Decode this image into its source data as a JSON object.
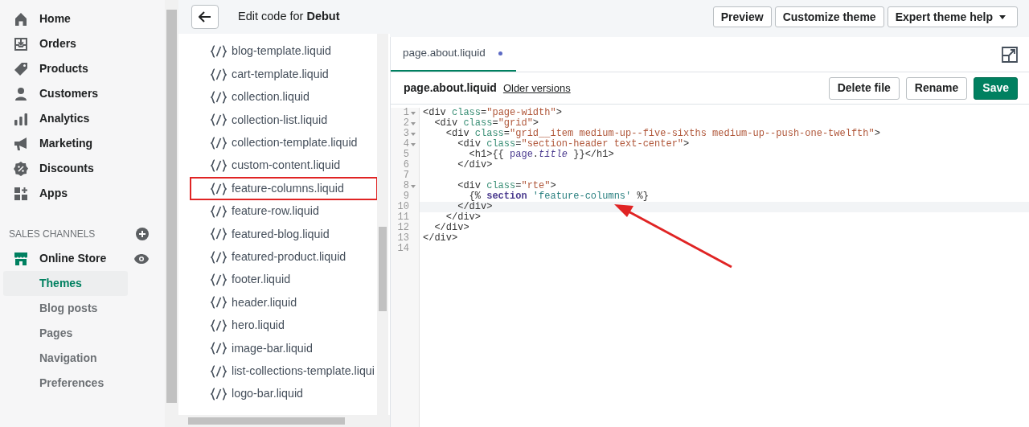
{
  "sidebar": {
    "items": [
      {
        "label": "Home",
        "kind": "home"
      },
      {
        "label": "Orders",
        "kind": "orders"
      },
      {
        "label": "Products",
        "kind": "tag"
      },
      {
        "label": "Customers",
        "kind": "person"
      },
      {
        "label": "Analytics",
        "kind": "bars"
      },
      {
        "label": "Marketing",
        "kind": "megaphone"
      },
      {
        "label": "Discounts",
        "kind": "discount"
      },
      {
        "label": "Apps",
        "kind": "apps"
      }
    ],
    "section_title": "SALES CHANNELS",
    "channel": {
      "label": "Online Store"
    },
    "subitems": [
      {
        "label": "Themes",
        "selected": true
      },
      {
        "label": "Blog posts",
        "selected": false
      },
      {
        "label": "Pages",
        "selected": false
      },
      {
        "label": "Navigation",
        "selected": false
      },
      {
        "label": "Preferences",
        "selected": false
      }
    ]
  },
  "header": {
    "title": "Edit code for **Debut**",
    "buttons": [
      {
        "label": "Preview",
        "kind": "plain"
      },
      {
        "label": "Customize theme",
        "kind": "plain"
      },
      {
        "label": "Expert theme help",
        "kind": "dropdown"
      }
    ]
  },
  "files": [
    {
      "name": "blog-template.liquid",
      "highlighted": false
    },
    {
      "name": "cart-template.liquid",
      "highlighted": false
    },
    {
      "name": "collection.liquid",
      "highlighted": false
    },
    {
      "name": "collection-list.liquid",
      "highlighted": false
    },
    {
      "name": "collection-template.liquid",
      "highlighted": false
    },
    {
      "name": "custom-content.liquid",
      "highlighted": false
    },
    {
      "name": "feature-columns.liquid",
      "highlighted": true
    },
    {
      "name": "feature-row.liquid",
      "highlighted": false
    },
    {
      "name": "featured-blog.liquid",
      "highlighted": false
    },
    {
      "name": "featured-product.liquid",
      "highlighted": false
    },
    {
      "name": "footer.liquid",
      "highlighted": false
    },
    {
      "name": "header.liquid",
      "highlighted": false
    },
    {
      "name": "hero.liquid",
      "highlighted": false
    },
    {
      "name": "image-bar.liquid",
      "highlighted": false
    },
    {
      "name": "list-collections-template.liqui",
      "highlighted": false
    },
    {
      "name": "logo-bar.liquid",
      "highlighted": false
    }
  ],
  "editor": {
    "tab": {
      "label": "page.about.liquid",
      "unsaved": true,
      "selected": true
    },
    "file_name": "page.about.liquid",
    "older_versions": "Older versions",
    "buttons": [
      {
        "label": "Delete file",
        "kind": "secondary"
      },
      {
        "label": "Rename",
        "kind": "secondary"
      },
      {
        "label": "Save",
        "kind": "primary"
      }
    ],
    "lines": [
      {
        "number": "1",
        "foldable": true,
        "active": false,
        "tokens": [
          {
            "kind": "tag",
            "text": "<div "
          },
          {
            "kind": "attr",
            "text": "class"
          },
          {
            "kind": "tag",
            "text": "="
          },
          {
            "kind": "string",
            "text": "\"page-width\""
          },
          {
            "kind": "tag",
            "text": ">"
          }
        ]
      },
      {
        "number": "2",
        "foldable": true,
        "active": false,
        "tokens": [
          {
            "kind": "tag",
            "text": "  <div "
          },
          {
            "kind": "attr",
            "text": "class"
          },
          {
            "kind": "tag",
            "text": "="
          },
          {
            "kind": "string",
            "text": "\"grid\""
          },
          {
            "kind": "tag",
            "text": ">"
          }
        ]
      },
      {
        "number": "3",
        "foldable": true,
        "active": false,
        "tokens": [
          {
            "kind": "tag",
            "text": "    <div "
          },
          {
            "kind": "attr",
            "text": "class"
          },
          {
            "kind": "tag",
            "text": "="
          },
          {
            "kind": "string",
            "text": "\"grid__item medium-up--five-sixths medium-up--push-one-twelfth\""
          },
          {
            "kind": "tag",
            "text": ">"
          }
        ]
      },
      {
        "number": "4",
        "foldable": true,
        "active": false,
        "tokens": [
          {
            "kind": "tag",
            "text": "      <div "
          },
          {
            "kind": "attr",
            "text": "class"
          },
          {
            "kind": "tag",
            "text": "="
          },
          {
            "kind": "string",
            "text": "\"section-header text-center\""
          },
          {
            "kind": "tag",
            "text": ">"
          }
        ]
      },
      {
        "number": "5",
        "foldable": false,
        "active": false,
        "tokens": [
          {
            "kind": "tag",
            "text": "        <h1>{{ "
          },
          {
            "kind": "var",
            "text": "page"
          },
          {
            "kind": "tag",
            "text": "."
          },
          {
            "kind": "prop",
            "text": "title"
          },
          {
            "kind": "tag",
            "text": " }}</h1>"
          }
        ]
      },
      {
        "number": "6",
        "foldable": false,
        "active": false,
        "tokens": [
          {
            "kind": "tag",
            "text": "      </div>"
          }
        ]
      },
      {
        "number": "7",
        "foldable": false,
        "active": false
      },
      {
        "number": "8",
        "foldable": true,
        "active": false,
        "tokens": [
          {
            "kind": "tag",
            "text": "      <div "
          },
          {
            "kind": "attr",
            "text": "class"
          },
          {
            "kind": "tag",
            "text": "="
          },
          {
            "kind": "string",
            "text": "\"rte\""
          },
          {
            "kind": "tag",
            "text": ">"
          }
        ]
      },
      {
        "number": "9",
        "foldable": false,
        "active": false,
        "tokens": [
          {
            "kind": "tag",
            "text": "        {% "
          },
          {
            "kind": "keyword",
            "text": "section"
          },
          {
            "kind": "liquid-string",
            "text": " 'feature-columns'"
          },
          {
            "kind": "tag",
            "text": " %}"
          }
        ]
      },
      {
        "number": "10",
        "foldable": false,
        "active": true,
        "tokens": [
          {
            "kind": "tag",
            "text": "      </div>"
          }
        ]
      },
      {
        "number": "11",
        "foldable": false,
        "active": false,
        "tokens": [
          {
            "kind": "tag",
            "text": "    </div>"
          }
        ]
      },
      {
        "number": "12",
        "foldable": false,
        "active": false,
        "tokens": [
          {
            "kind": "tag",
            "text": "  </div>"
          }
        ]
      },
      {
        "number": "13",
        "foldable": false,
        "active": false,
        "tokens": [
          {
            "kind": "tag",
            "text": "</div>"
          }
        ]
      },
      {
        "number": "14",
        "foldable": false,
        "active": false
      }
    ]
  }
}
